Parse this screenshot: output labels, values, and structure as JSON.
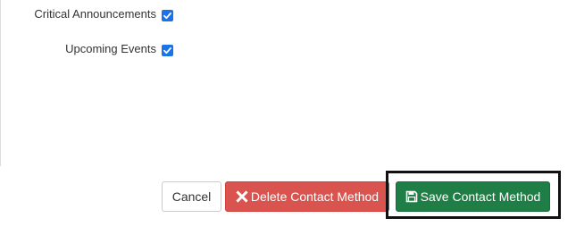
{
  "preferences": [
    {
      "label": "Critical Announcements",
      "checked": true
    },
    {
      "label": "Upcoming Events",
      "checked": true
    }
  ],
  "actions": {
    "cancel_label": "Cancel",
    "delete_label": "Delete Contact Method",
    "delete_icon": "close-x-icon",
    "save_label": "Save Contact Method",
    "save_icon": "floppy-disk-icon"
  },
  "colors": {
    "checkbox": "#1a73e8",
    "delete": "#d9534f",
    "save": "#1e7e45",
    "highlight_border": "#111111"
  }
}
